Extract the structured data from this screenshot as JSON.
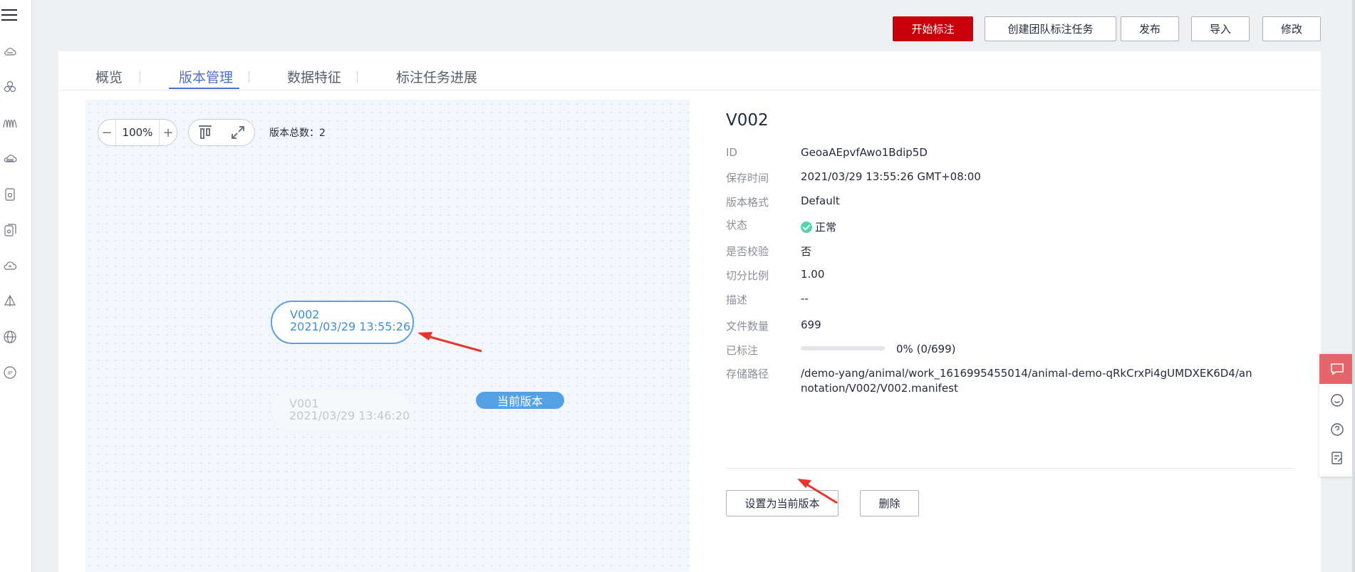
{
  "colors": {
    "primary": "#c7000b",
    "accent": "#526ecc",
    "node_blue": "#5aa2e6",
    "success": "#50d4ab"
  },
  "sidebar": {
    "icons": [
      "menu-icon",
      "cloud-storage-icon",
      "cluster-icon",
      "waveform-icon",
      "database-icon",
      "file-icon",
      "file-group-icon",
      "cloud-icon",
      "prism-icon",
      "globe-icon",
      "ip-icon"
    ]
  },
  "toolbar": {
    "start_label": "开始标注",
    "team_label": "创建团队标注任务",
    "publish_label": "发布",
    "import_label": "导入",
    "modify_label": "修改"
  },
  "tabs": [
    {
      "label": "概览",
      "active": false
    },
    {
      "label": "版本管理",
      "active": true
    },
    {
      "label": "数据特征",
      "active": false
    },
    {
      "label": "标注任务进展",
      "active": false
    }
  ],
  "graph": {
    "zoom": "100%",
    "zoom_out": "−",
    "zoom_in": "+",
    "version_count_label": "版本总数：2",
    "nodes": [
      {
        "name": "V002",
        "time": "2021/03/29 13:55:26",
        "selected": true
      },
      {
        "name": "V001",
        "time": "2021/03/29 13:46:20",
        "selected": false
      }
    ],
    "current_badge": "当前版本"
  },
  "detail": {
    "title": "V002",
    "fields": {
      "id": {
        "label": "ID",
        "value": "GeoaAEpvfAwo1Bdip5D"
      },
      "saved": {
        "label": "保存时间",
        "value": "2021/03/29 13:55:26 GMT+08:00"
      },
      "format": {
        "label": "版本格式",
        "value": "Default"
      },
      "status": {
        "label": "状态",
        "value": "正常"
      },
      "verify": {
        "label": "是否校验",
        "value": "否"
      },
      "split": {
        "label": "切分比例",
        "value": "1.00"
      },
      "desc": {
        "label": "描述",
        "value": "--"
      },
      "files": {
        "label": "文件数量",
        "value": "699"
      },
      "annotated": {
        "label": "已标注",
        "value": "0% (0/699)",
        "progress": 0
      },
      "path": {
        "label": "存储路径",
        "value": "/demo-yang/animal/work_1616995455014/animal-demo-qRkCrxPi4gUMDXEK6D4/annotation/V002/V002.manifest"
      }
    },
    "set_current_label": "设置为当前版本",
    "delete_label": "删除"
  }
}
